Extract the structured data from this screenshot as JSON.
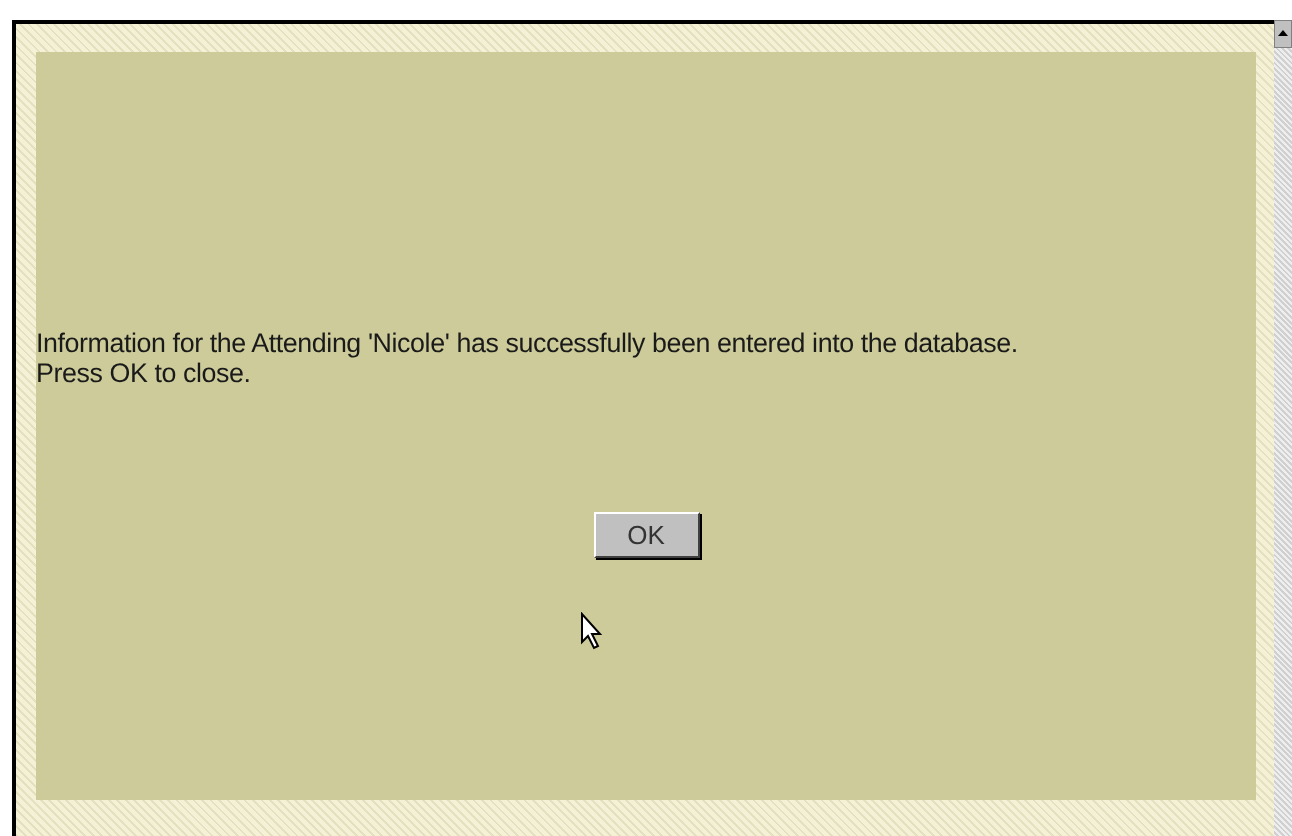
{
  "message_lines": [
    "Information for the Attending 'Nicole' has successfully been entered into the database.",
    "Press OK to close."
  ],
  "button": {
    "label": "OK"
  }
}
